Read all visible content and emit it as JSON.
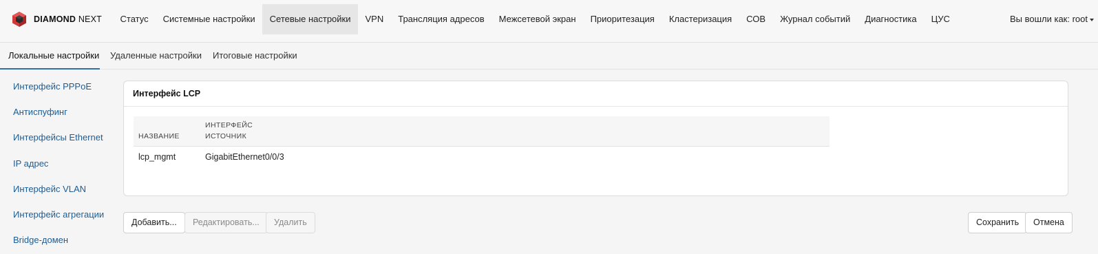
{
  "app": {
    "brand_bold": "DIAMOND",
    "brand_light": "NEXT",
    "logo_icon": "red-cube-logo-icon",
    "accent_color": "#2f6fa8"
  },
  "nav": {
    "items": [
      {
        "label": "Статус"
      },
      {
        "label": "Системные настройки"
      },
      {
        "label": "Сетевые настройки",
        "active": true
      },
      {
        "label": "VPN"
      },
      {
        "label": "Трансляция адресов"
      },
      {
        "label": "Межсетевой экран"
      },
      {
        "label": "Приоритезация"
      },
      {
        "label": "Кластеризация"
      },
      {
        "label": "СОВ"
      },
      {
        "label": "Журнал событий"
      },
      {
        "label": "Диагностика"
      },
      {
        "label": "ЦУС"
      }
    ],
    "user_label": "Вы вошли как: root"
  },
  "subtabs": [
    {
      "label": "Локальные настройки",
      "active": true
    },
    {
      "label": "Удаленные настройки"
    },
    {
      "label": "Итоговые настройки"
    }
  ],
  "sidebar": {
    "items": [
      {
        "label": "Интерфейс PPPoE"
      },
      {
        "label": "Антиспуфинг"
      },
      {
        "label": "Интерфейсы Ethernet"
      },
      {
        "label": "IP адрес"
      },
      {
        "label": "Интерфейс VLAN"
      },
      {
        "label": "Интерфейс агрегации"
      },
      {
        "label": "Bridge-домен"
      }
    ]
  },
  "panel": {
    "title": "Интерфейс LCP",
    "columns": [
      "НАЗВАНИЕ",
      "ИНТЕРФЕЙС ИСТОЧНИК"
    ],
    "rows": [
      {
        "name": "lcp_mgmt",
        "source": "GigabitEthernet0/0/3"
      }
    ]
  },
  "buttons": {
    "add": "Добавить...",
    "edit": "Редактировать...",
    "delete": "Удалить",
    "save": "Сохранить",
    "cancel": "Отмена"
  }
}
